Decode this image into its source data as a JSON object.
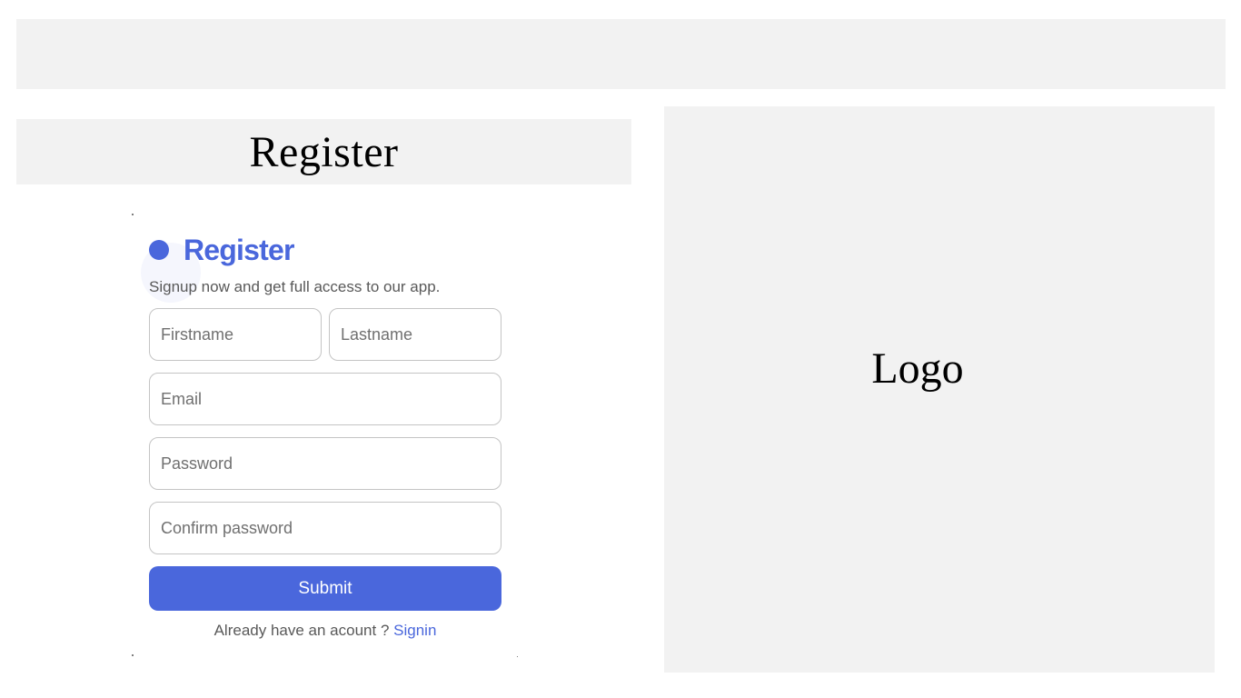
{
  "header": {
    "title": "Register"
  },
  "logo_panel": {
    "text": "Logo"
  },
  "form": {
    "title": "Register",
    "subtitle": "Signup now and get full access to our app.",
    "firstname_placeholder": "Firstname",
    "lastname_placeholder": "Lastname",
    "email_placeholder": "Email",
    "password_placeholder": "Password",
    "confirm_password_placeholder": "Confirm password",
    "submit_label": "Submit",
    "signin_prompt": "Already have an acount ?",
    "signin_link": "Signin"
  },
  "colors": {
    "accent": "#4a67dc",
    "panel_bg": "#f2f2f2",
    "border": "#c4c4c4"
  },
  "icons": {
    "title_dot": "circle-dot-icon"
  }
}
